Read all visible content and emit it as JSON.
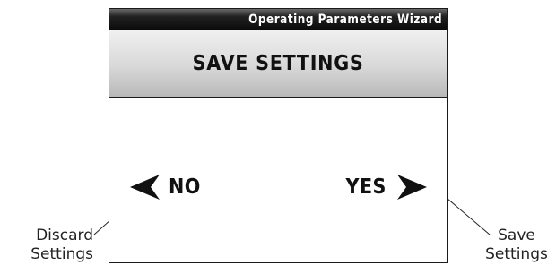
{
  "window": {
    "title": "Operating Parameters Wizard"
  },
  "screen": {
    "heading": "SAVE SETTINGS",
    "choices": {
      "no_label": "NO",
      "yes_label": "YES"
    }
  },
  "annotations": {
    "left": {
      "line1": "Discard",
      "line2": "Settings"
    },
    "right": {
      "line1": "Save",
      "line2": "Settings"
    }
  },
  "colors": {
    "title_bar": "#111111",
    "heading_band": "#d0d0d0",
    "text": "#111111"
  },
  "icons": {
    "no_arrow": "arrow-left-icon",
    "yes_arrow": "arrow-right-icon"
  }
}
